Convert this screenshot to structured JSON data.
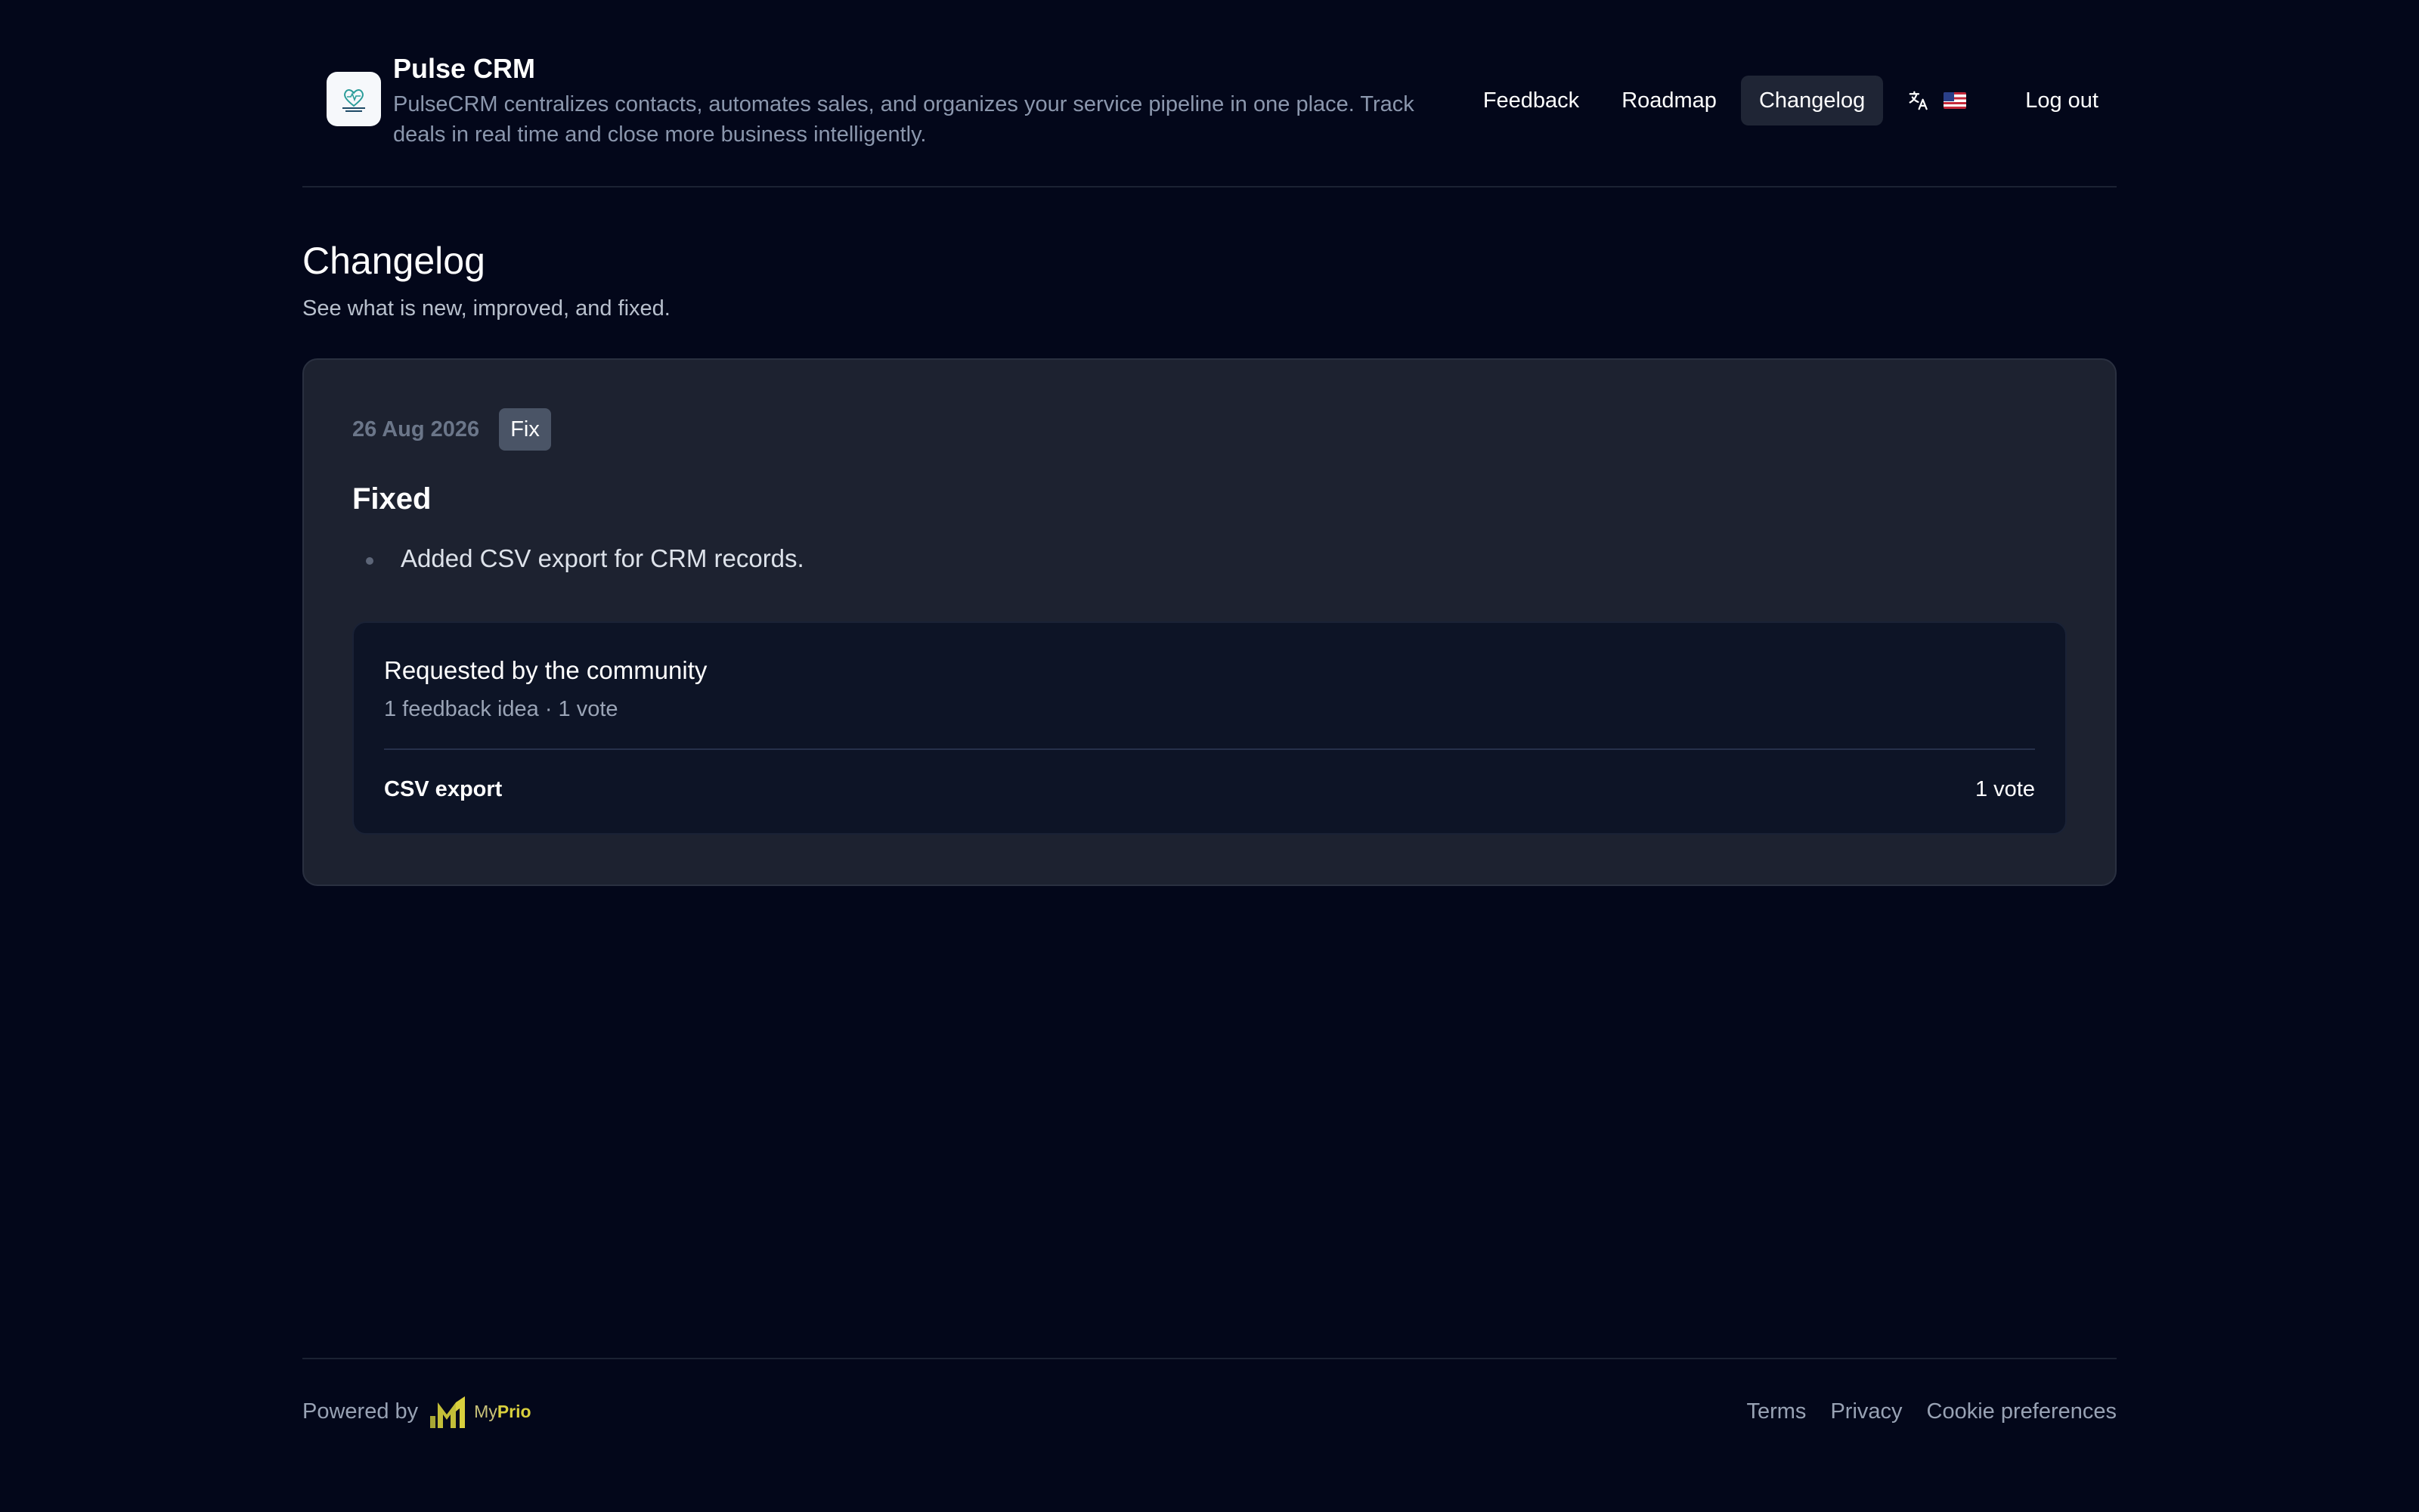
{
  "header": {
    "brand_name": "Pulse CRM",
    "brand_description": "PulseCRM centralizes contacts, automates sales, and organizes your service pipeline in one place. Track deals in real time and close more business intelligently.",
    "logo_text": "PULSE CRM",
    "nav": {
      "feedback": "Feedback",
      "roadmap": "Roadmap",
      "changelog": "Changelog",
      "logout": "Log out"
    },
    "active_nav": "changelog",
    "language_icon": "translate-icon",
    "language_flag": "us-flag-icon"
  },
  "page": {
    "title": "Changelog",
    "subtitle": "See what is new, improved, and fixed."
  },
  "entries": [
    {
      "date": "26 Aug 2026",
      "badge": "Fix",
      "heading": "Fixed",
      "items": [
        "Added CSV export for CRM records."
      ],
      "community": {
        "title": "Requested by the community",
        "stats": "1 feedback idea · 1 vote",
        "ideas": [
          {
            "title": "CSV export",
            "votes": "1 vote"
          }
        ]
      }
    }
  ],
  "footer": {
    "powered_by": "Powered by",
    "brand_prefix": "My",
    "brand_suffix": "Prio",
    "links": {
      "terms": "Terms",
      "privacy": "Privacy",
      "cookies": "Cookie preferences"
    }
  },
  "colors": {
    "background": "#03071a",
    "card": "#1d2230",
    "inner_card": "#0d1426",
    "badge": "#4a5466",
    "brand_accent": "#d9d03d"
  }
}
